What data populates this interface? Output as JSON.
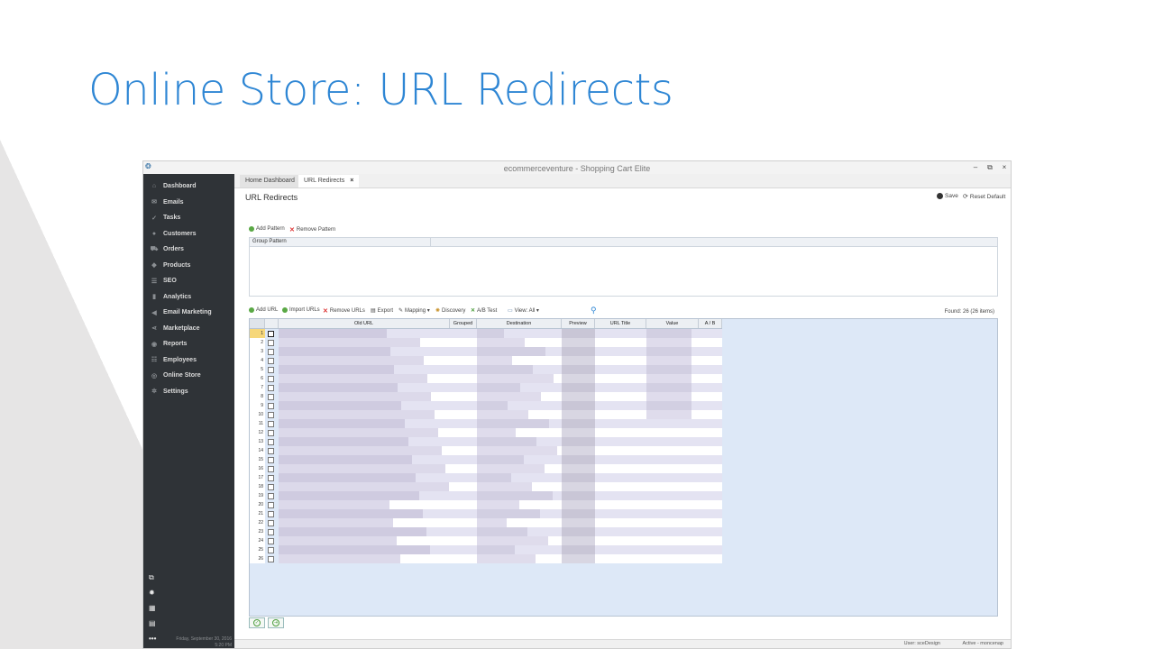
{
  "slide": {
    "title": "Online Store: URL Redirects"
  },
  "window": {
    "title": "ecommerceventure - Shopping Cart Elite",
    "controls": [
      "–",
      "⧉",
      "×"
    ]
  },
  "sidebar": {
    "items": [
      {
        "label": "Dashboard",
        "icon": "home-icon"
      },
      {
        "label": "Emails",
        "icon": "mail-icon"
      },
      {
        "label": "Tasks",
        "icon": "tasks-icon"
      },
      {
        "label": "Customers",
        "icon": "user-icon"
      },
      {
        "label": "Orders",
        "icon": "cart-icon"
      },
      {
        "label": "Products",
        "icon": "tag-icon"
      },
      {
        "label": "SEO",
        "icon": "seo-icon"
      },
      {
        "label": "Analytics",
        "icon": "bar-chart-icon"
      },
      {
        "label": "Email Marketing",
        "icon": "megaphone-icon"
      },
      {
        "label": "Marketplace",
        "icon": "share-icon"
      },
      {
        "label": "Reports",
        "icon": "report-icon"
      },
      {
        "label": "Employees",
        "icon": "employees-icon"
      },
      {
        "label": "Online Store",
        "icon": "globe-icon"
      },
      {
        "label": "Settings",
        "icon": "gear-icon"
      }
    ],
    "date": "Friday, September 30, 2016",
    "time": "5:20 PM"
  },
  "tabs": [
    {
      "label": "Home Dashboard"
    },
    {
      "label": "URL Redirects",
      "close": "×"
    }
  ],
  "page": {
    "title": "URL Redirects",
    "save_label": "Save",
    "reset_label": "Reset Default"
  },
  "pattern_toolbar": {
    "add": "Add Pattern",
    "remove": "Remove Pattern"
  },
  "pattern_grid": {
    "header": "Group Pattern"
  },
  "url_toolbar": {
    "add": "Add URL",
    "import": "Import URLs",
    "remove": "Remove URLs",
    "export": "Export",
    "mapping": "Mapping ▾",
    "discovery": "Discovery",
    "ab_test": "A/B Test",
    "view": "View: All ▾"
  },
  "found": "Found: 26 (26 items)",
  "grid": {
    "columns": [
      "Old URL",
      "Grouped",
      "Destination",
      "Preview",
      "URL Title",
      "Value",
      "A / B"
    ],
    "rows": [
      "1",
      "2",
      "3",
      "4",
      "5",
      "6",
      "7",
      "8",
      "9",
      "10",
      "11",
      "12",
      "13",
      "14",
      "15",
      "16",
      "17",
      "18",
      "19",
      "20",
      "21",
      "22",
      "23",
      "24",
      "25",
      "26"
    ]
  },
  "status": {
    "user": "User: sceDesign",
    "active": "Active - moncenap"
  },
  "colors": {
    "accent": "#2e86d4",
    "sidebar": "#2f3337",
    "grid_bg": "#dde8f7",
    "row_alt": "#e4e3f2"
  }
}
